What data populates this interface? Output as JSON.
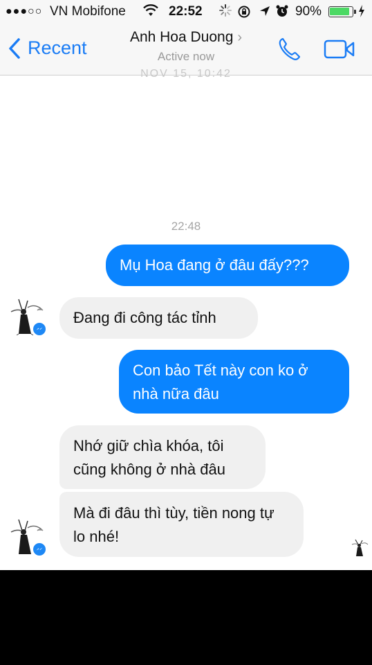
{
  "status_bar": {
    "signal_dots": "●●●○○",
    "carrier": "VN Mobifone",
    "time": "22:52",
    "battery_percent": "90%",
    "battery_level": 0.9
  },
  "nav": {
    "back_label": "Recent",
    "contact_name": "Anh Hoa Duong",
    "chevron": "›",
    "status": "Active now"
  },
  "conversation": {
    "faded_date": "NOV 15, 10:42",
    "timestamp": "22:48",
    "messages": [
      {
        "sender": "me",
        "text": "Mụ Hoa đang ở đâu đấy???"
      },
      {
        "sender": "them",
        "text": "Đang đi công tác tỉnh"
      },
      {
        "sender": "me",
        "text": "Con bảo Tết này con ko ở nhà nữa đâu"
      },
      {
        "sender": "them",
        "text": "Nhớ giữ chìa khóa, tôi cũng không ở nhà đâu"
      },
      {
        "sender": "them",
        "text": "Mà đi đâu thì tùy, tiền nong tự lo nhé!"
      }
    ]
  },
  "colors": {
    "accent": "#1a7cf5",
    "outgoing_bubble": "#0a84ff",
    "incoming_bubble": "#f0f0f0",
    "battery": "#4cd964"
  },
  "icons": {
    "back": "chevron-left-icon",
    "call": "phone-icon",
    "video": "video-camera-icon",
    "messenger_badge": "messenger-badge-icon"
  }
}
